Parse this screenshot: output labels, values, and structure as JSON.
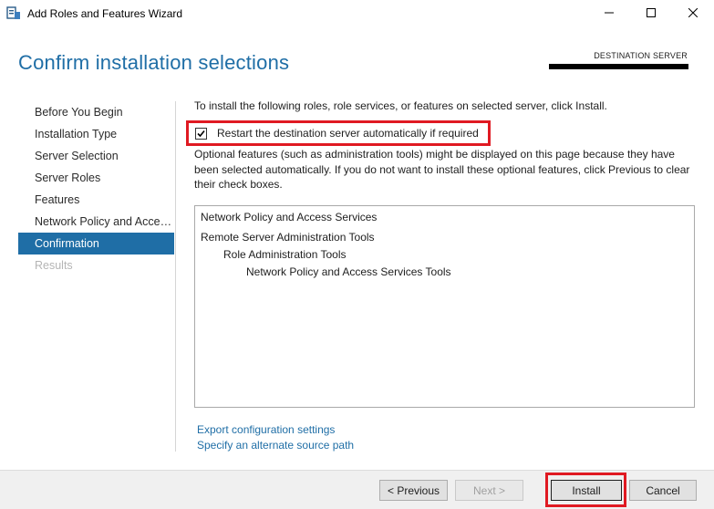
{
  "window": {
    "title": "Add Roles and Features Wizard"
  },
  "header": {
    "page_title": "Confirm installation selections",
    "destination_label": "DESTINATION SERVER"
  },
  "nav": {
    "items": [
      {
        "label": "Before You Begin",
        "state": "normal"
      },
      {
        "label": "Installation Type",
        "state": "normal"
      },
      {
        "label": "Server Selection",
        "state": "normal"
      },
      {
        "label": "Server Roles",
        "state": "normal"
      },
      {
        "label": "Features",
        "state": "normal"
      },
      {
        "label": "Network Policy and Access Services",
        "state": "normal"
      },
      {
        "label": "Confirmation",
        "state": "active"
      },
      {
        "label": "Results",
        "state": "disabled"
      }
    ]
  },
  "main": {
    "intro": "To install the following roles, role services, or features on selected server, click Install.",
    "restart_checkbox": {
      "label": "Restart the destination server automatically if required",
      "checked": true
    },
    "optional_text": "Optional features (such as administration tools) might be displayed on this page because they have been selected automatically. If you do not want to install these optional features, click Previous to clear their check boxes.",
    "features": [
      {
        "label": "Network Policy and Access Services",
        "level": 0
      },
      {
        "label": "Remote Server Administration Tools",
        "level": 0
      },
      {
        "label": "Role Administration Tools",
        "level": 1
      },
      {
        "label": "Network Policy and Access Services Tools",
        "level": 2
      }
    ],
    "links": {
      "export": "Export configuration settings",
      "alternate_source": "Specify an alternate source path"
    }
  },
  "footer": {
    "previous": "< Previous",
    "next": "Next >",
    "install": "Install",
    "cancel": "Cancel"
  },
  "colors": {
    "accent": "#1f6ea6",
    "highlight": "#e01a22"
  }
}
